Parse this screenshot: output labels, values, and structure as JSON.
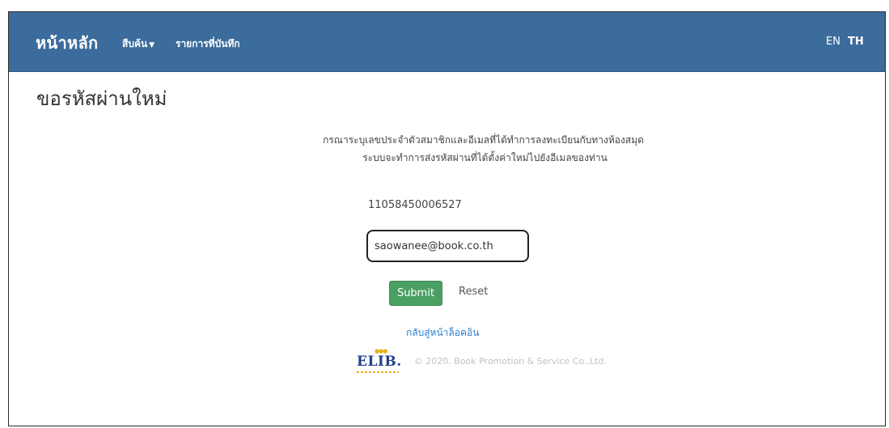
{
  "navbar": {
    "brand": "หน้าหลัก",
    "search_menu": "สืบค้น",
    "records_menu": "รายการที่บันทึก",
    "lang_en": "EN",
    "lang_th": "TH",
    "bg_color": "#3b6c9c"
  },
  "main": {
    "title": "ขอรหัสผ่านใหม่",
    "info_line1": "กรณาระบุเลขประจำตัวสมาชิกและอีเมลที่ได้ทำการลงทะเบียนกับทางห้องสมุด",
    "info_line2": "ระบบจะทำการส่งรหัสผ่านที่ได้ตั้งค่าใหม่ไปยังอีเมลของท่าน",
    "member_id": "11058450006527",
    "email_value": "saowanee@book.co.th",
    "submit_label": "Submit",
    "reset_label": "Reset",
    "back_link": "กลับสู่หน้าล็อคอิน"
  },
  "footer": {
    "logo_text": "ELIB.",
    "copyright": "© 2020. Book Promotion & Service Co.,Ltd."
  }
}
